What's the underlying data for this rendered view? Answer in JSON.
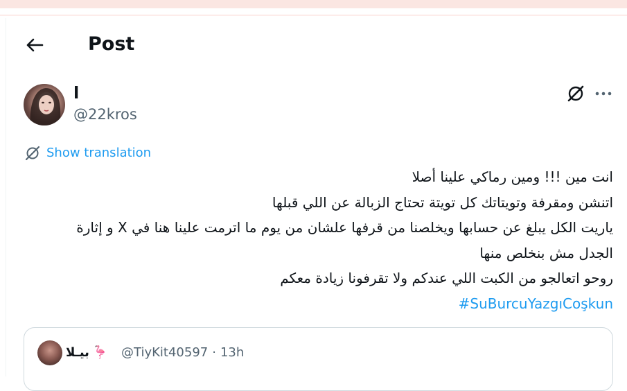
{
  "header": {
    "title": "Post",
    "back_icon": "arrow-left-icon"
  },
  "author": {
    "display_name": "ا",
    "handle": "@22kros"
  },
  "actions": {
    "grok_icon": "grok-icon",
    "more_icon": "more-horizontal-icon"
  },
  "translation": {
    "label": "Show translation",
    "icon": "translate-icon"
  },
  "tweet": {
    "lines": [
      "انت مين !!! ومين رماكي علينا أصلا",
      "اتنشن ومقرفة وتويتاتك كل تويتة تحتاج الزبالة عن اللي قبلها",
      "ياريت الكل يبلغ عن حسابها ويخلصنا من قرفها علشان من يوم ما اترمت علينا هنا في X و إثارة",
      "الجدل مش بنخلص منها",
      "روحو اتعالجو من الكبت اللي عندكم ولا تقرفونا زيادة معكم"
    ],
    "hashtag": "#SuBurcuYazgıCoşkun"
  },
  "quote": {
    "name": "بيـلا",
    "emoji": "🦩",
    "handle": "@TiyKit40597",
    "separator": "·",
    "time": "13h"
  },
  "colors": {
    "link": "#1d9bf0",
    "secondary_text": "#536471",
    "border": "#cfd9de"
  }
}
